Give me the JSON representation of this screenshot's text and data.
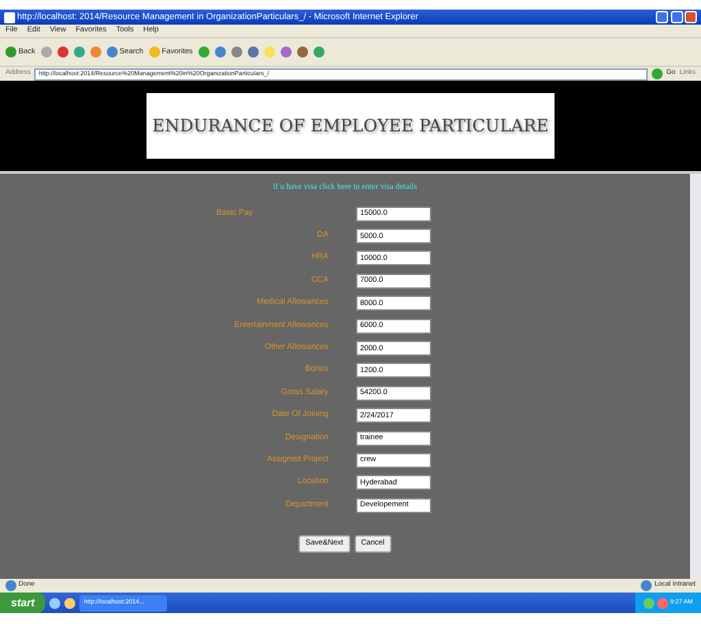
{
  "window": {
    "title": "http://localhost: 2014/Resource Management in OrganizationParticulars_/ - Microsoft Internet Explorer"
  },
  "menu": [
    "File",
    "Edit",
    "View",
    "Favorites",
    "Tools",
    "Help"
  ],
  "toolbar": {
    "back": "Back",
    "search": "Search",
    "favorites": "Favorites"
  },
  "address_bar": {
    "label": "Address",
    "value": "http://localhost:2014/Resource%20Management%20in%20OrganizationParticulars_/",
    "go": "Go",
    "links": "Links"
  },
  "banner": {
    "title": "ENDURANCE OF EMPLOYEE PARTICULARE"
  },
  "visa_link": "if u have visa click here to enter visa details",
  "fields": [
    {
      "label": "Basic Pay",
      "value": "15000.0"
    },
    {
      "label": "DA",
      "value": "5000.0"
    },
    {
      "label": "HRA",
      "value": "10000.0"
    },
    {
      "label": "CCA",
      "value": "7000.0"
    },
    {
      "label": "Medical Allowances",
      "value": "8000.0"
    },
    {
      "label": "Entertainment Allowances",
      "value": "6000.0"
    },
    {
      "label": "Other Allowances",
      "value": "2000.0"
    },
    {
      "label": "Bonus",
      "value": "1200.0"
    },
    {
      "label": "Gross Salary",
      "value": "54200.0"
    },
    {
      "label": "Date Of Joining",
      "value": "2/24/2017"
    },
    {
      "label": "Designation",
      "value": "trainee"
    },
    {
      "label": "Assigned Project",
      "value": "crew"
    },
    {
      "label": "Location",
      "value": "Hyderabad"
    },
    {
      "label": "Department",
      "value": "Developement"
    }
  ],
  "buttons": [
    "Save&Next",
    "Cancel"
  ],
  "status_bar": {
    "text": "Done",
    "zone": "Local intranet"
  },
  "taskbar": {
    "start": "start",
    "task": "http://localhost:2014...",
    "clock": "9:27 AM"
  }
}
